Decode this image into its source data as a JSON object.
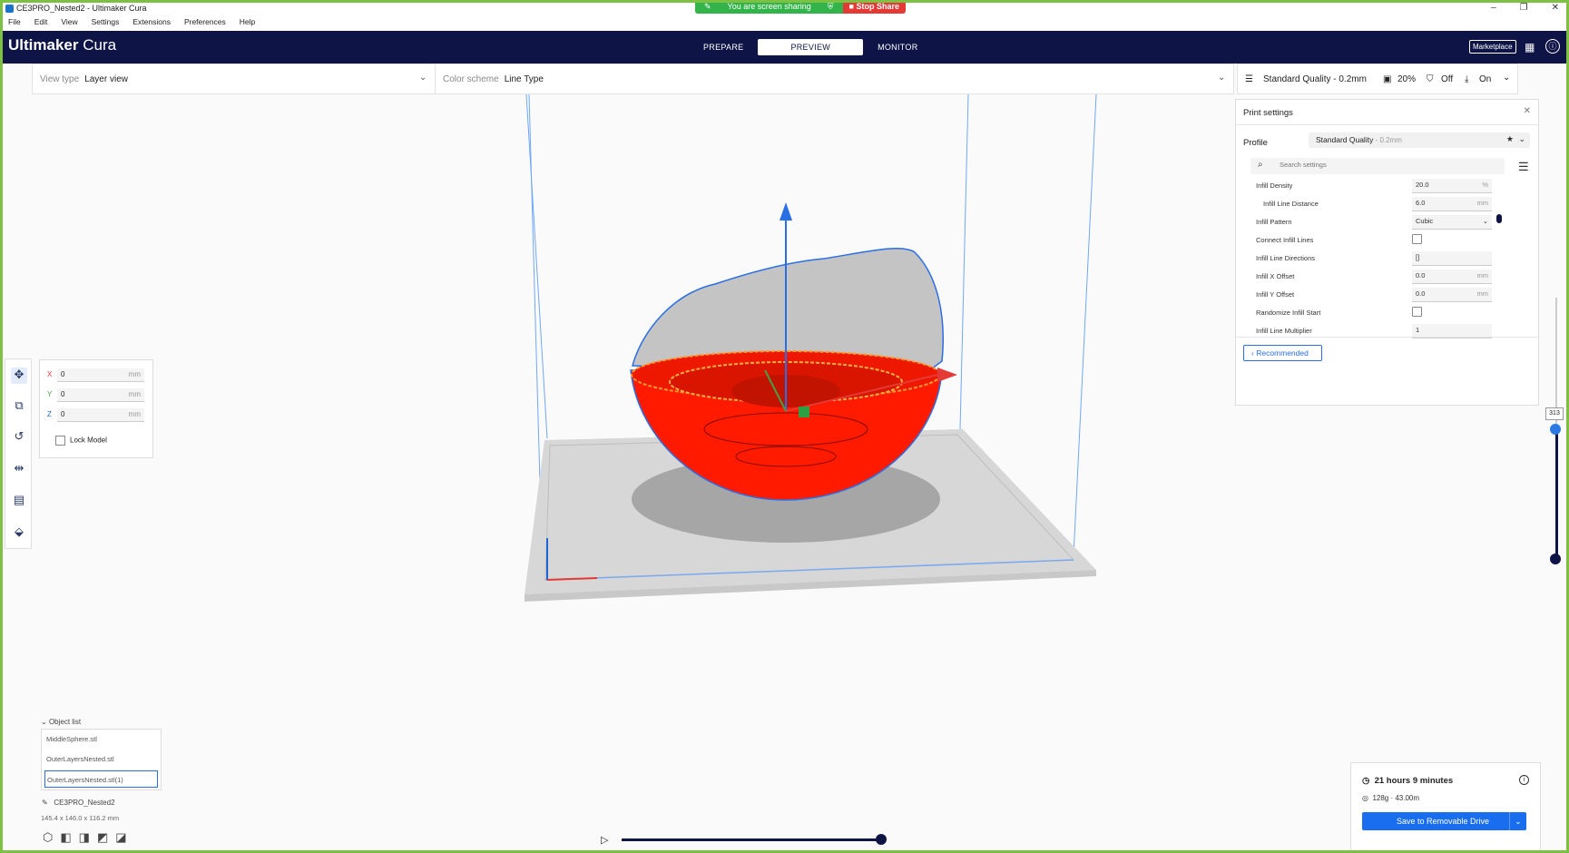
{
  "window": {
    "title": "CE3PRO_Nested2 - Ultimaker Cura",
    "controls": [
      "–",
      "❐",
      "✕"
    ]
  },
  "screen_share": {
    "status": "You are screen sharing",
    "stop_label": "Stop Share"
  },
  "menubar": [
    "File",
    "Edit",
    "View",
    "Settings",
    "Extensions",
    "Preferences",
    "Help"
  ],
  "header": {
    "logo_bold": "Ultimaker",
    "logo_light": " Cura",
    "stages": [
      "PREPARE",
      "PREVIEW",
      "MONITOR"
    ],
    "active_stage": "PREVIEW",
    "marketplace": "Marketplace"
  },
  "viewbar": {
    "view_type_label": "View type",
    "view_type_value": "Layer view",
    "color_scheme_label": "Color scheme",
    "color_scheme_value": "Line Type"
  },
  "quality_bar": {
    "profile": "Standard Quality - 0.2mm",
    "infill": "20%",
    "support": "Off",
    "adhesion": "On"
  },
  "print_settings": {
    "title": "Print settings",
    "close": "✕",
    "profile_label": "Profile",
    "profile_value": "Standard Quality",
    "profile_suffix": " - 0.2mm",
    "search_placeholder": "Search settings",
    "rows": [
      {
        "label": "Infill Density",
        "value": "20.0",
        "unit": "%",
        "type": "field"
      },
      {
        "label": "Infill Line Distance",
        "value": "6.0",
        "unit": "mm",
        "type": "field",
        "indent": true
      },
      {
        "label": "Infill Pattern",
        "value": "Cubic",
        "unit": "⌄",
        "type": "field"
      },
      {
        "label": "Connect Infill Lines",
        "value": "",
        "unit": "",
        "type": "check"
      },
      {
        "label": "Infill Line Directions",
        "value": "[]",
        "unit": "",
        "type": "field"
      },
      {
        "label": "Infill X Offset",
        "value": "0.0",
        "unit": "mm",
        "type": "field"
      },
      {
        "label": "Infill Y Offset",
        "value": "0.0",
        "unit": "mm",
        "type": "field"
      },
      {
        "label": "Randomize Infill Start",
        "value": "",
        "unit": "",
        "type": "check"
      },
      {
        "label": "Infill Line Multiplier",
        "value": "1",
        "unit": "",
        "type": "field"
      }
    ],
    "recommended_label": "Recommended"
  },
  "layer_slider": {
    "current_layer": "313"
  },
  "move_tool": {
    "x_label": "X",
    "x_value": "0",
    "x_unit": "mm",
    "y_label": "Y",
    "y_value": "0",
    "y_unit": "mm",
    "z_label": "Z",
    "z_value": "0",
    "z_unit": "mm",
    "lock_label": "Lock Model",
    "axis_colors": {
      "x": "#e53935",
      "y": "#43a047",
      "z": "#1e63d6"
    }
  },
  "object_list": {
    "header": "Object list",
    "items": [
      "MiddleSphere.stl",
      "OuterLayersNested.stl",
      "OuterLayersNested.stl(1)"
    ],
    "selected_index": 2,
    "project_name": "CE3PRO_Nested2",
    "dimensions": "145.4 x 146.0 x 116.2 mm"
  },
  "estimate": {
    "time": "21 hours 9 minutes",
    "material": "128g · 43.00m",
    "save_label": "Save to Removable Drive"
  },
  "colors": {
    "header_bg": "#0e1546",
    "accent": "#196ef0",
    "model_red": "#ff1a00",
    "share_green": "#32b44a",
    "share_red": "#e53935"
  }
}
